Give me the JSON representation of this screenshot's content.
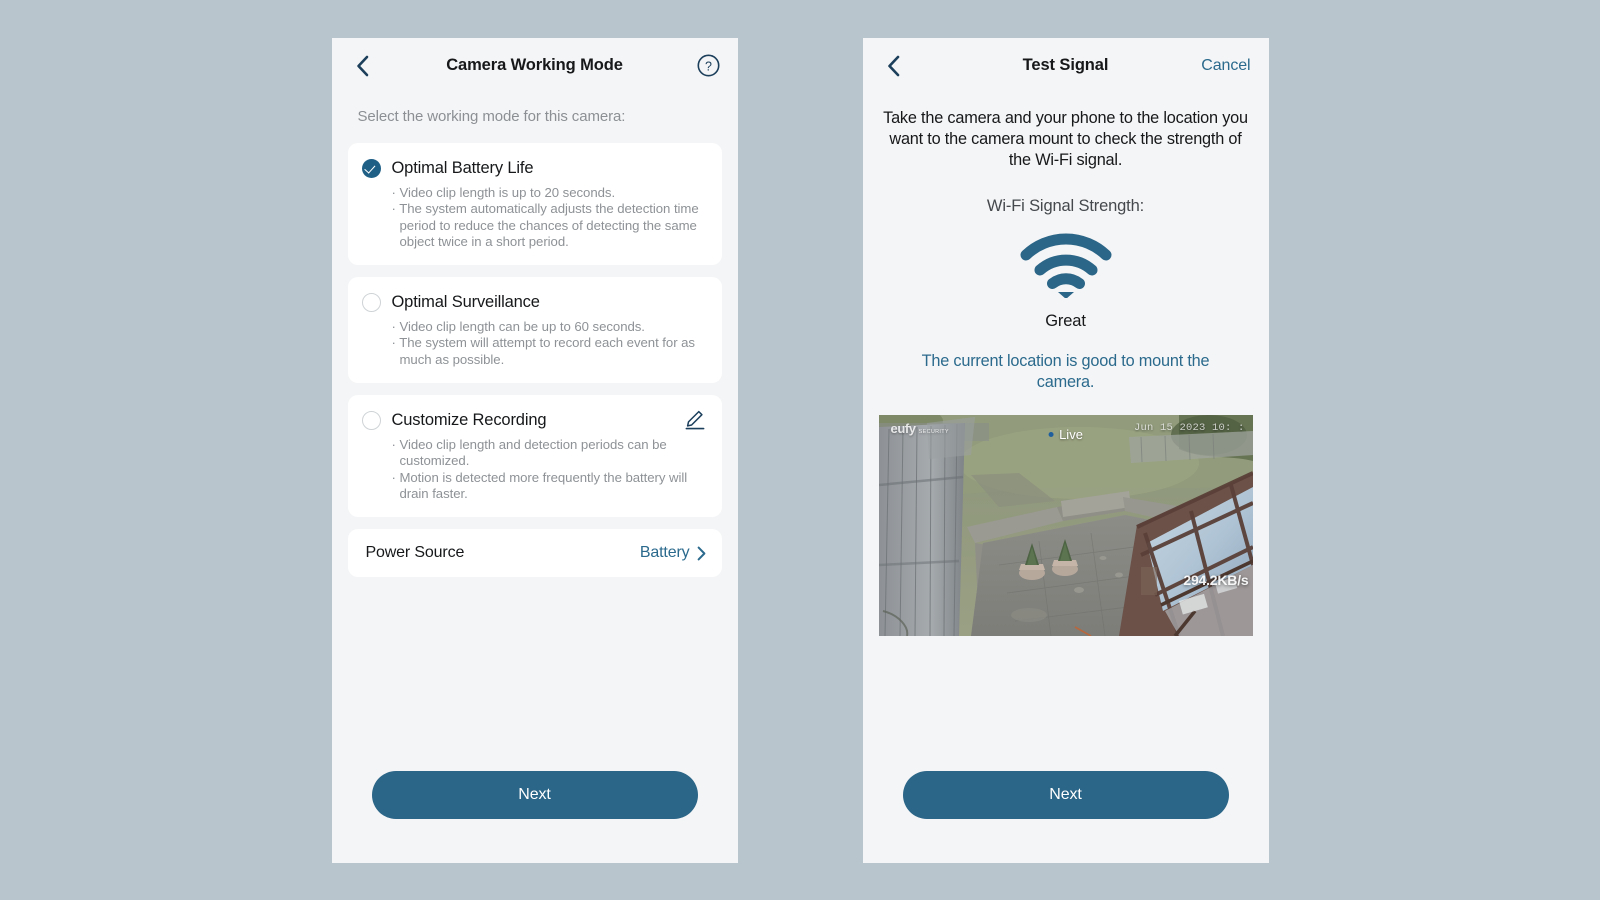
{
  "background_color": "#b8c5cc",
  "accent_color": "#2b6587",
  "link_color": "#2b6a8d",
  "left_screen": {
    "nav": {
      "back_icon": "chevron-left-icon",
      "title": "Camera Working Mode",
      "help_icon": "help-circle-icon"
    },
    "subtitle": "Select the working mode for this camera:",
    "options": [
      {
        "title": "Optimal Battery Life",
        "selected": true,
        "has_edit": false,
        "bullets": [
          "· Video clip length is up to 20 seconds.",
          "· The system automatically adjusts the detection time period to reduce the chances of detecting the same object twice in a short period."
        ]
      },
      {
        "title": "Optimal Surveillance",
        "selected": false,
        "has_edit": false,
        "bullets": [
          "· Video clip length can be up to 60 seconds.",
          "· The system will attempt to record each event for as much as possible."
        ]
      },
      {
        "title": "Customize Recording",
        "selected": false,
        "has_edit": true,
        "edit_icon": "pencil-edit-icon",
        "bullets": [
          "· Video clip length and detection periods can be customized.",
          "· Motion is detected more frequently the battery will drain faster."
        ]
      }
    ],
    "power_source": {
      "label": "Power Source",
      "value": "Battery",
      "chevron_icon": "chevron-right-icon"
    },
    "primary_button": "Next"
  },
  "right_screen": {
    "nav": {
      "back_icon": "chevron-left-icon",
      "title": "Test Signal",
      "cancel_label": "Cancel"
    },
    "intro": "Take the camera and your phone to the location you want to the camera mount to check the strength of the Wi-Fi signal.",
    "signal": {
      "label": "Wi-Fi Signal Strength:",
      "icon": "wifi-full-icon",
      "value": "Great",
      "bars": 3,
      "bars_total": 3,
      "icon_color": "#2b6587"
    },
    "advice": "The current location is good to mount the camera.",
    "camera_feed": {
      "brand": "eufy",
      "brand_sub": "SECURITY",
      "live_label": "Live",
      "timestamp": "Jun 15 2023  10:  :  ",
      "bitrate": "294.2KB/s",
      "scene": "overhead backyard view with wooden fence, lawn, paved patio, two potted plants and a glass conservatory roof"
    },
    "primary_button": "Next"
  }
}
